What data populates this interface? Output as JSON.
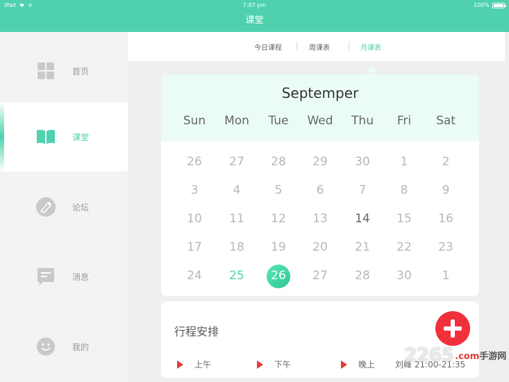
{
  "status_bar": {
    "carrier": "iPad",
    "time": "7:07 pm",
    "battery": "100%"
  },
  "navbar": {
    "title": "课堂"
  },
  "sidebar": {
    "items": [
      {
        "label": "首页",
        "icon": "grid-icon",
        "active": false
      },
      {
        "label": "课堂",
        "icon": "book-icon",
        "active": true
      },
      {
        "label": "论坛",
        "icon": "forum-icon",
        "active": false
      },
      {
        "label": "消息",
        "icon": "message-icon",
        "active": false
      },
      {
        "label": "我的",
        "icon": "smiley-icon",
        "active": false
      }
    ]
  },
  "tabs": [
    {
      "label": "今日课程",
      "active": false
    },
    {
      "label": "周课表",
      "active": false
    },
    {
      "label": "月课表",
      "active": true
    }
  ],
  "calendar": {
    "month": "Septemper",
    "weekdays": [
      "Sun",
      "Mon",
      "Tue",
      "Wed",
      "Thu",
      "Fri",
      "Sat"
    ],
    "weeks": [
      [
        "26",
        "27",
        "28",
        "29",
        "30",
        "1",
        "2"
      ],
      [
        "3",
        "4",
        "5",
        "6",
        "7",
        "8",
        "9"
      ],
      [
        "10",
        "11",
        "12",
        "13",
        "14",
        "15",
        "16"
      ],
      [
        "17",
        "18",
        "19",
        "20",
        "21",
        "22",
        "23"
      ],
      [
        "24",
        "25",
        "26",
        "27",
        "28",
        "30",
        "1"
      ]
    ],
    "highlight_day": "25",
    "selected_day": "26",
    "emphasized_day": "14"
  },
  "schedule": {
    "title": "行程安排",
    "periods": [
      "上午",
      "下午",
      "晚上"
    ],
    "detail": "刘峰 21:00-21:35"
  },
  "watermark": {
    "number": "2265",
    "text_prefix": ".com",
    "text_site": "手游网"
  },
  "colors": {
    "accent": "#4fd1ae",
    "add_button": "#f0303b",
    "period_marker": "#e53935"
  }
}
